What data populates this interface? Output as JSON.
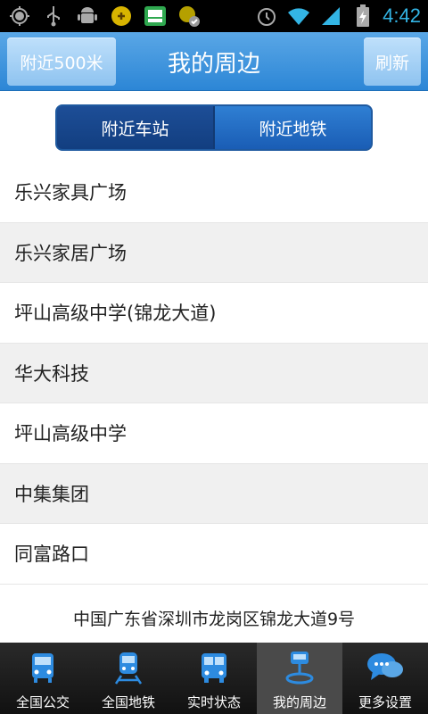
{
  "status_bar": {
    "time": "4:42",
    "left_icons": [
      "location-icon",
      "usb-icon",
      "android-icon",
      "app-icon",
      "bus-app-icon",
      "sync-icon"
    ],
    "right_icons": [
      "alarm-icon",
      "wifi-icon",
      "signal-icon",
      "battery-icon"
    ]
  },
  "header": {
    "left_button": "附近500米",
    "title": "我的周边",
    "right_button": "刷新"
  },
  "segments": [
    {
      "label": "附近车站",
      "active": true
    },
    {
      "label": "附近地铁",
      "active": false
    }
  ],
  "list": [
    {
      "label": "乐兴家具广场"
    },
    {
      "label": "乐兴家居广场"
    },
    {
      "label": "坪山高级中学(锦龙大道)"
    },
    {
      "label": "华大科技"
    },
    {
      "label": "坪山高级中学"
    },
    {
      "label": "中集集团"
    },
    {
      "label": "同富路口"
    }
  ],
  "address": "中国广东省深圳市龙岗区锦龙大道9号",
  "tabs": [
    {
      "label": "全国公交",
      "icon": "bus-icon"
    },
    {
      "label": "全国地铁",
      "icon": "subway-icon"
    },
    {
      "label": "实时状态",
      "icon": "realtime-bus-icon"
    },
    {
      "label": "我的周边",
      "icon": "nearby-icon",
      "active": true
    },
    {
      "label": "更多设置",
      "icon": "chat-bubbles-icon"
    }
  ],
  "colors": {
    "header_blue": "#2c86d6",
    "segment_blue": "#1a5db5",
    "status_blue": "#33b5e5",
    "tab_icon_blue": "#2d8be0"
  }
}
